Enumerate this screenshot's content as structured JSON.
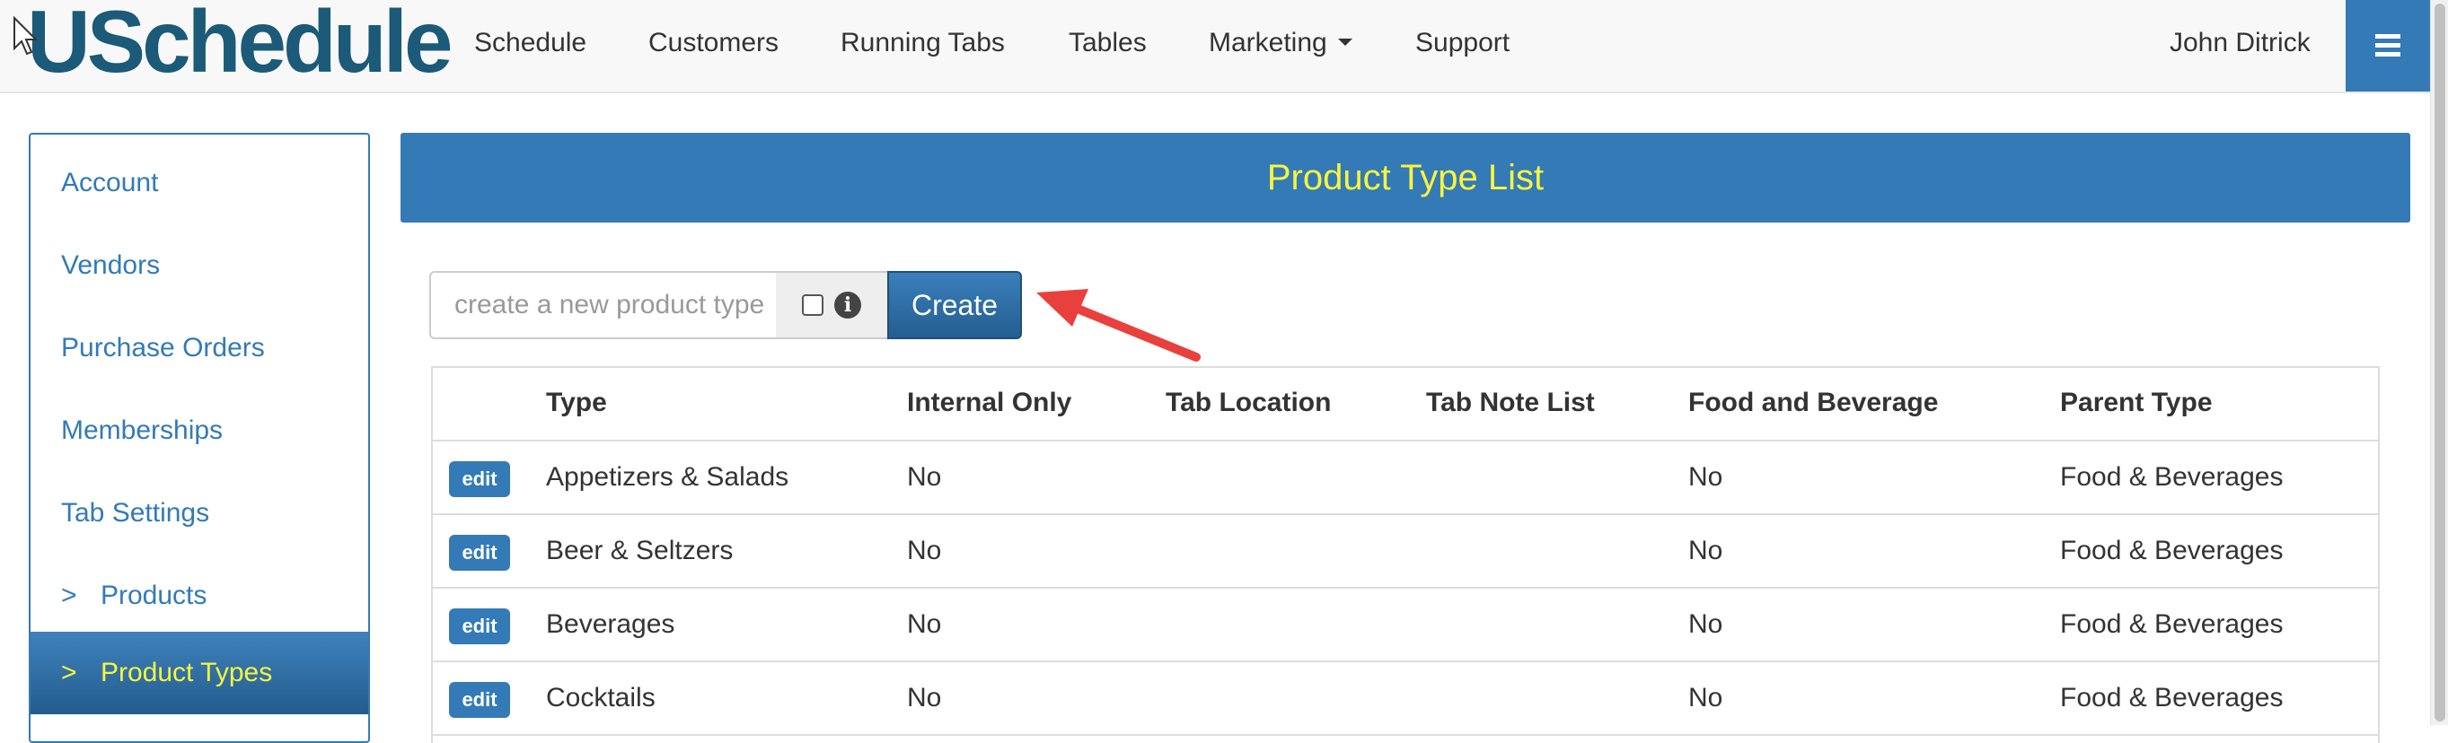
{
  "brand": {
    "name": "USchedule",
    "color": "#1b5a78"
  },
  "nav": {
    "items": [
      "Schedule",
      "Customers",
      "Running Tabs",
      "Tables",
      "Marketing",
      "Support"
    ],
    "user": "John Ditrick",
    "menu_icon": "hamburger-icon"
  },
  "sidebar": {
    "items": [
      {
        "label": "Account",
        "prefix": ""
      },
      {
        "label": "Vendors",
        "prefix": ""
      },
      {
        "label": "Purchase Orders",
        "prefix": ""
      },
      {
        "label": "Memberships",
        "prefix": ""
      },
      {
        "label": "Tab Settings",
        "prefix": ""
      },
      {
        "label": "Products",
        "prefix": ">"
      },
      {
        "label": "Product Types",
        "prefix": ">"
      }
    ],
    "active_index": 6
  },
  "page": {
    "title": "Product Type List",
    "title_color": "#f8f53c",
    "accent": "#337ab7"
  },
  "create": {
    "placeholder": "create a new product type",
    "button_label": "Create",
    "info_icon": "info-icon"
  },
  "table": {
    "columns": [
      "Type",
      "Internal Only",
      "Tab Location",
      "Tab Note List",
      "Food and Beverage",
      "Parent Type"
    ],
    "edit_label": "edit",
    "rows": [
      {
        "type": "Appetizers & Salads",
        "internal_only": "No",
        "tab_location": "",
        "tab_note_list": "",
        "food_and_beverage": "No",
        "parent_type": "Food & Beverages"
      },
      {
        "type": "Beer & Seltzers",
        "internal_only": "No",
        "tab_location": "",
        "tab_note_list": "",
        "food_and_beverage": "No",
        "parent_type": "Food & Beverages"
      },
      {
        "type": "Beverages",
        "internal_only": "No",
        "tab_location": "",
        "tab_note_list": "",
        "food_and_beverage": "No",
        "parent_type": "Food & Beverages"
      },
      {
        "type": "Cocktails",
        "internal_only": "No",
        "tab_location": "",
        "tab_note_list": "",
        "food_and_beverage": "No",
        "parent_type": "Food & Beverages"
      }
    ]
  }
}
